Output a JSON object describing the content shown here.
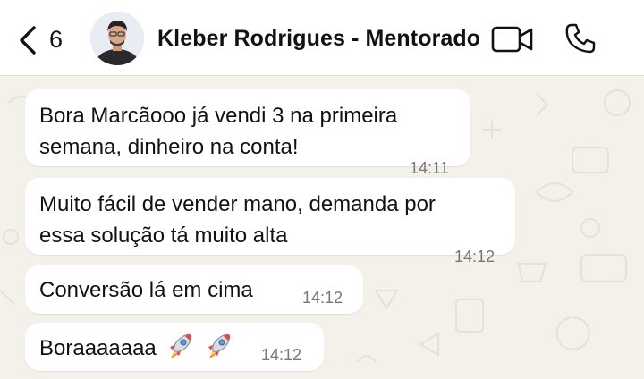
{
  "header": {
    "unread_count": "6",
    "contact_name": "Kleber Rodrigues - Mentorado"
  },
  "messages": [
    {
      "lines": [
        "Bora Marcãooo já vendi 3 na primeira",
        "semana, dinheiro na conta!"
      ],
      "time": "14:11"
    },
    {
      "lines": [
        "Muito fácil de vender mano, demanda por",
        "essa solução tá muito alta"
      ],
      "time": "14:12"
    },
    {
      "lines": [
        "Conversão lá em cima"
      ],
      "time": "14:12"
    },
    {
      "lines": [
        "Boraaaaaaa"
      ],
      "emojis": [
        "rocket-icon",
        "rocket-icon"
      ],
      "time": "14:12"
    }
  ],
  "colors": {
    "chat_background": "#f4f1ea",
    "bubble_background": "#ffffff",
    "timestamp": "#777777"
  }
}
